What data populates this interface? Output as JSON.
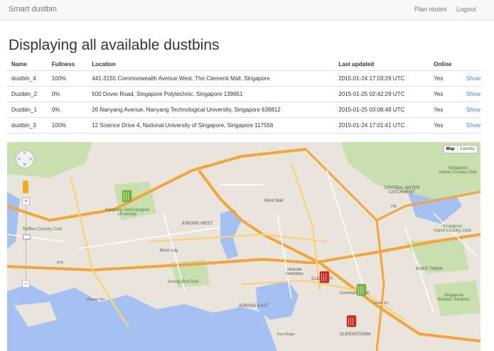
{
  "navbar": {
    "brand": "Smart dustbin",
    "links": [
      "Plan routes",
      "Logout"
    ]
  },
  "page": {
    "title": "Displaying all available dustbins"
  },
  "table": {
    "headers": [
      "Name",
      "Fullness",
      "Location",
      "Last updated",
      "Online",
      ""
    ],
    "rows": [
      {
        "name": "dustbin_4",
        "fullness": "100%",
        "location": "441-3155 Commonwealth Avenue West, The Clementi Mall, Singapore",
        "updated": "2015-01-24 17:03:29 UTC",
        "online": "Yes",
        "action": "Show"
      },
      {
        "name": "Dustbin_2",
        "fullness": "0%",
        "location": "500 Dover Road, Singapore Polytechnic, Singapore 139651",
        "updated": "2015-01-25 02:42:29 UTC",
        "online": "Yes",
        "action": "Show"
      },
      {
        "name": "Dustbin_1",
        "fullness": "0%",
        "location": "26 Nanyang Avenue, Nanyang Technological University, Singapore 639812",
        "updated": "2015-01-25 03:06:48 UTC",
        "online": "Yes",
        "action": "Show"
      },
      {
        "name": "dustbin_3",
        "fullness": "100%",
        "location": "12 Science Drive 4, National University of Singapore, Singapore 117556",
        "updated": "2015-01-24 17:01:41 UTC",
        "online": "Yes",
        "action": "Show"
      }
    ]
  },
  "map": {
    "type_buttons": [
      "Map",
      "Satellite"
    ],
    "pan_arrows": [
      "^",
      "<",
      ">",
      "v"
    ],
    "zoom": {
      "in": "+",
      "out": "−"
    },
    "labels": {
      "ntu": "Nanyang Technological\nUniversity",
      "raffles": "Raffles Country Club",
      "jurong_west": "JURONG WEST",
      "boon_lay": "Boon Lay",
      "west_mall": "West Mall",
      "jurong_bird_park": "Jurong Bird Park",
      "jurong_east": "JURONG EAST",
      "clementi": "CLEMENTI",
      "pandan_gardens": "PANDAN\nGARDENS",
      "commonwealth": "Commonwealth",
      "queenstown": "QUEENSTOWN",
      "bukit_timah": "BUKIT TIMAH",
      "central_water": "CENTRAL WATER\nCATCHMENT",
      "sg_island_cc": "Singapore\nIsland Country Club",
      "sg_botanic": "Singapore\nBotanic Gardens",
      "pioneer": "Pioneer Rd",
      "aye": "AYE",
      "pie": "PIE",
      "dover": "Dover Rd",
      "kent": "Kent Ridge"
    },
    "colors": {
      "water": "#a4c1f2",
      "land": "#e9e5dc",
      "park": "#c9dfaf",
      "highway": "#f3a53b",
      "road": "#fefefe",
      "full": "#cc2b24",
      "empty": "#74b343"
    }
  }
}
